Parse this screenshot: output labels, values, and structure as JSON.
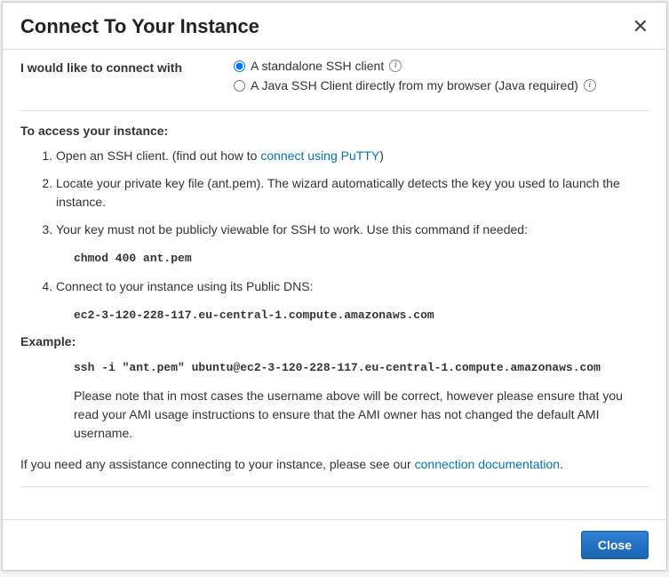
{
  "dialog": {
    "title": "Connect To Your Instance",
    "close_glyph": "✕"
  },
  "connect": {
    "label": "I would like to connect with",
    "options": [
      {
        "label": "A standalone SSH client",
        "checked": true
      },
      {
        "label": "A Java SSH Client directly from my browser (Java required)",
        "checked": false
      }
    ]
  },
  "access": {
    "heading": "To access your instance:",
    "step1_pre": "Open an SSH client. (find out how to ",
    "step1_link": "connect using PuTTY",
    "step1_post": ")",
    "step2": "Locate your private key file (ant.pem). The wizard automatically detects the key you used to launch the instance.",
    "step3": "Your key must not be publicly viewable for SSH to work. Use this command if needed:",
    "chmod_cmd": "chmod 400 ant.pem",
    "step4": "Connect to your instance using its Public DNS:",
    "public_dns": "ec2-3-120-228-117.eu-central-1.compute.amazonaws.com"
  },
  "example": {
    "heading": "Example:",
    "ssh_cmd": "ssh -i \"ant.pem\" ubuntu@ec2-3-120-228-117.eu-central-1.compute.amazonaws.com",
    "note": "Please note that in most cases the username above will be correct, however please ensure that you read your AMI usage instructions to ensure that the AMI owner has not changed the default AMI username."
  },
  "assist": {
    "pre": "If you need any assistance connecting to your instance, please see our ",
    "link": "connection documentation",
    "post": "."
  },
  "footer": {
    "close_label": "Close"
  },
  "info_glyph": "i"
}
